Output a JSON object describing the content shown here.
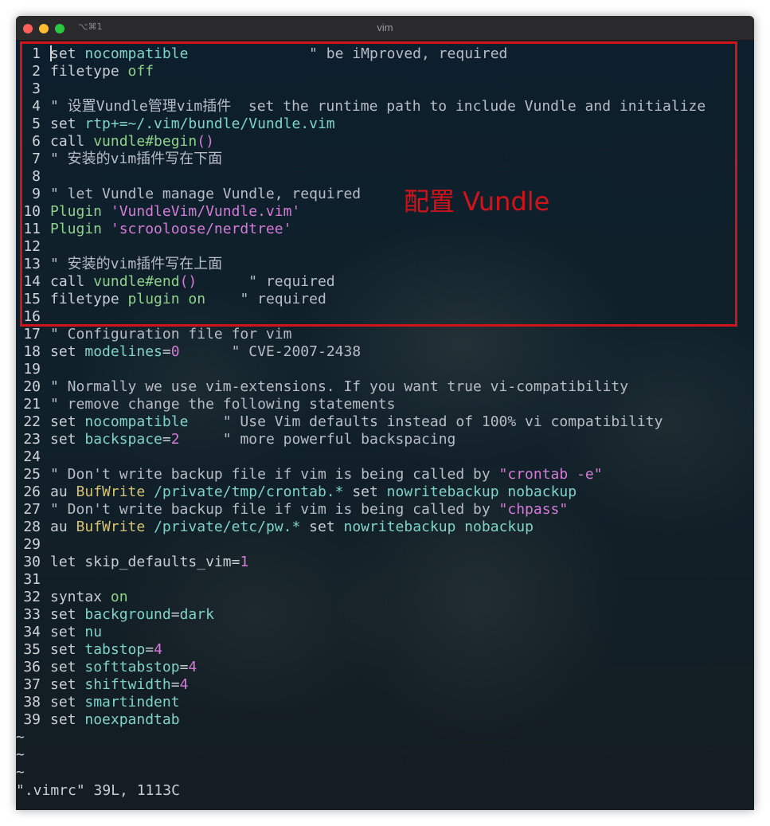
{
  "window": {
    "title": "vim",
    "shortcut": "⌥⌘1"
  },
  "colors": {
    "highlight": "#d2141a",
    "string": "#d37bd6",
    "option": "#7fd3c8"
  },
  "annotation": "配置 Vundle",
  "lines": [
    {
      "n": "1",
      "cursor": true,
      "tokens": [
        [
          "kw",
          "set "
        ],
        [
          "opt",
          "nocompatible"
        ],
        [
          "cm",
          "              \" be iMproved, required"
        ]
      ]
    },
    {
      "n": "2",
      "tokens": [
        [
          "kw",
          "filetype "
        ],
        [
          "fn",
          "off"
        ]
      ]
    },
    {
      "n": "3",
      "tokens": []
    },
    {
      "n": "4",
      "tokens": [
        [
          "cm",
          "\" 设置Vundle管理vim插件  set the runtime path to include Vundle and initialize"
        ]
      ]
    },
    {
      "n": "5",
      "tokens": [
        [
          "kw",
          "set "
        ],
        [
          "opt",
          "rtp+=~/.vim/bundle/Vundle.vim"
        ]
      ]
    },
    {
      "n": "6",
      "tokens": [
        [
          "kw",
          "call "
        ],
        [
          "fn",
          "vundle#begin"
        ],
        [
          "paren",
          "()"
        ]
      ]
    },
    {
      "n": "7",
      "tokens": [
        [
          "cm",
          "\" 安装的vim插件写在下面"
        ]
      ]
    },
    {
      "n": "8",
      "tokens": []
    },
    {
      "n": "9",
      "tokens": [
        [
          "cm",
          "\" let Vundle manage Vundle, required"
        ]
      ]
    },
    {
      "n": "10",
      "tokens": [
        [
          "fn",
          "Plugin "
        ],
        [
          "str",
          "'VundleVim/Vundle.vim'"
        ]
      ]
    },
    {
      "n": "11",
      "tokens": [
        [
          "fn",
          "Plugin "
        ],
        [
          "str",
          "'scrooloose/nerdtree'"
        ]
      ]
    },
    {
      "n": "12",
      "tokens": []
    },
    {
      "n": "13",
      "tokens": [
        [
          "cm",
          "\" 安装的vim插件写在上面"
        ]
      ]
    },
    {
      "n": "14",
      "tokens": [
        [
          "kw",
          "call "
        ],
        [
          "fn",
          "vundle#end"
        ],
        [
          "paren",
          "()"
        ],
        [
          "cm",
          "      \" required"
        ]
      ]
    },
    {
      "n": "15",
      "tokens": [
        [
          "kw",
          "filetype "
        ],
        [
          "fn",
          "plugin on"
        ],
        [
          "cm",
          "    \" required"
        ]
      ]
    },
    {
      "n": "16",
      "tokens": []
    },
    {
      "n": "17",
      "tokens": [
        [
          "cm",
          "\" Configuration file for vim"
        ]
      ]
    },
    {
      "n": "18",
      "tokens": [
        [
          "kw",
          "set "
        ],
        [
          "opt",
          "modelines"
        ],
        [
          "kw",
          "="
        ],
        [
          "num",
          "0"
        ],
        [
          "cm",
          "      \" CVE-2007-2438"
        ]
      ]
    },
    {
      "n": "19",
      "tokens": []
    },
    {
      "n": "20",
      "tokens": [
        [
          "cm",
          "\" Normally we use vim-extensions. If you want true vi-compatibility"
        ]
      ]
    },
    {
      "n": "21",
      "tokens": [
        [
          "cm",
          "\" remove change the following statements"
        ]
      ]
    },
    {
      "n": "22",
      "tokens": [
        [
          "kw",
          "set "
        ],
        [
          "opt",
          "nocompatible"
        ],
        [
          "cm",
          "    \" Use Vim defaults instead of 100% vi compatibility"
        ]
      ]
    },
    {
      "n": "23",
      "tokens": [
        [
          "kw",
          "set "
        ],
        [
          "opt",
          "backspace"
        ],
        [
          "kw",
          "="
        ],
        [
          "num",
          "2"
        ],
        [
          "cm",
          "     \" more powerful backspacing"
        ]
      ]
    },
    {
      "n": "24",
      "tokens": []
    },
    {
      "n": "25",
      "tokens": [
        [
          "cm",
          "\" Don't write backup file if vim is being called by "
        ],
        [
          "str",
          "\"crontab -e\""
        ]
      ]
    },
    {
      "n": "26",
      "tokens": [
        [
          "kw",
          "au "
        ],
        [
          "grp",
          "BufWrite "
        ],
        [
          "path",
          "/private/tmp/crontab.* "
        ],
        [
          "kw",
          "set "
        ],
        [
          "opt",
          "nowritebackup nobackup"
        ]
      ]
    },
    {
      "n": "27",
      "tokens": [
        [
          "cm",
          "\" Don't write backup file if vim is being called by "
        ],
        [
          "str",
          "\"chpass\""
        ]
      ]
    },
    {
      "n": "28",
      "tokens": [
        [
          "kw",
          "au "
        ],
        [
          "grp",
          "BufWrite "
        ],
        [
          "path",
          "/private/etc/pw.* "
        ],
        [
          "kw",
          "set "
        ],
        [
          "opt",
          "nowritebackup nobackup"
        ]
      ]
    },
    {
      "n": "29",
      "tokens": []
    },
    {
      "n": "30",
      "tokens": [
        [
          "kw",
          "let "
        ],
        [
          "kw",
          "skip_defaults_vim="
        ],
        [
          "num",
          "1"
        ]
      ]
    },
    {
      "n": "31",
      "tokens": []
    },
    {
      "n": "32",
      "tokens": [
        [
          "kw",
          "syntax "
        ],
        [
          "fn",
          "on"
        ]
      ]
    },
    {
      "n": "33",
      "tokens": [
        [
          "kw",
          "set "
        ],
        [
          "opt",
          "background"
        ],
        [
          "kw",
          "="
        ],
        [
          "opt",
          "dark"
        ]
      ]
    },
    {
      "n": "34",
      "tokens": [
        [
          "kw",
          "set "
        ],
        [
          "opt",
          "nu"
        ]
      ]
    },
    {
      "n": "35",
      "tokens": [
        [
          "kw",
          "set "
        ],
        [
          "opt",
          "tabstop"
        ],
        [
          "kw",
          "="
        ],
        [
          "num",
          "4"
        ]
      ]
    },
    {
      "n": "36",
      "tokens": [
        [
          "kw",
          "set "
        ],
        [
          "opt",
          "softtabstop"
        ],
        [
          "kw",
          "="
        ],
        [
          "num",
          "4"
        ]
      ]
    },
    {
      "n": "37",
      "tokens": [
        [
          "kw",
          "set "
        ],
        [
          "opt",
          "shiftwidth"
        ],
        [
          "kw",
          "="
        ],
        [
          "num",
          "4"
        ]
      ]
    },
    {
      "n": "38",
      "tokens": [
        [
          "kw",
          "set "
        ],
        [
          "opt",
          "smartindent"
        ]
      ]
    },
    {
      "n": "39",
      "tokens": [
        [
          "kw",
          "set "
        ],
        [
          "opt",
          "noexpandtab"
        ]
      ]
    }
  ],
  "tildes": [
    "~",
    "~",
    "~"
  ],
  "status_line": "\".vimrc\" 39L, 1113C"
}
